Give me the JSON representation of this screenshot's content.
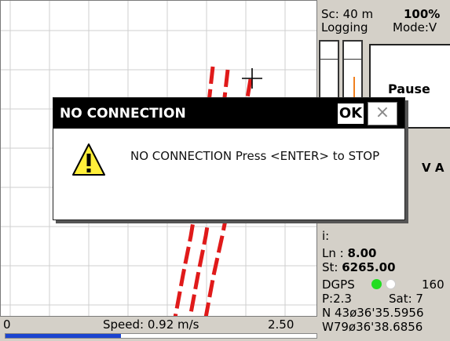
{
  "dialog": {
    "title": "NO CONNECTION",
    "ok_label": "OK",
    "close_glyph": "×",
    "message": "NO CONNECTION Press <ENTER> to STOP",
    "icon": "warning-icon"
  },
  "status": {
    "scale": "Sc:  40 m",
    "zoom": "100%",
    "logging": "Logging",
    "mode": "Mode:V"
  },
  "panel": {
    "pause_label": "Pause",
    "v_label": "V A",
    "i_label": "i:",
    "ln_prefix": "Ln : ",
    "ln_value": "8.00",
    "st_prefix": "St:  ",
    "st_value": "6265.00",
    "dgps_label": "DGPS",
    "dgps_value": "160",
    "p_label": "P:2.3",
    "sat_label": "Sat:  7",
    "north": "N 43ø36'35.5956",
    "west": "W79ø36'38.6856"
  },
  "bottom": {
    "left_value": "0",
    "speed": "Speed: 0.92 m/s",
    "right_value": "2.50",
    "speed_fraction": 0.37
  },
  "colors": {
    "track": "#e01a1a",
    "progress": "#1b44d0",
    "dgps_on": "#22dd22",
    "dgps_off": "#ffffff"
  }
}
